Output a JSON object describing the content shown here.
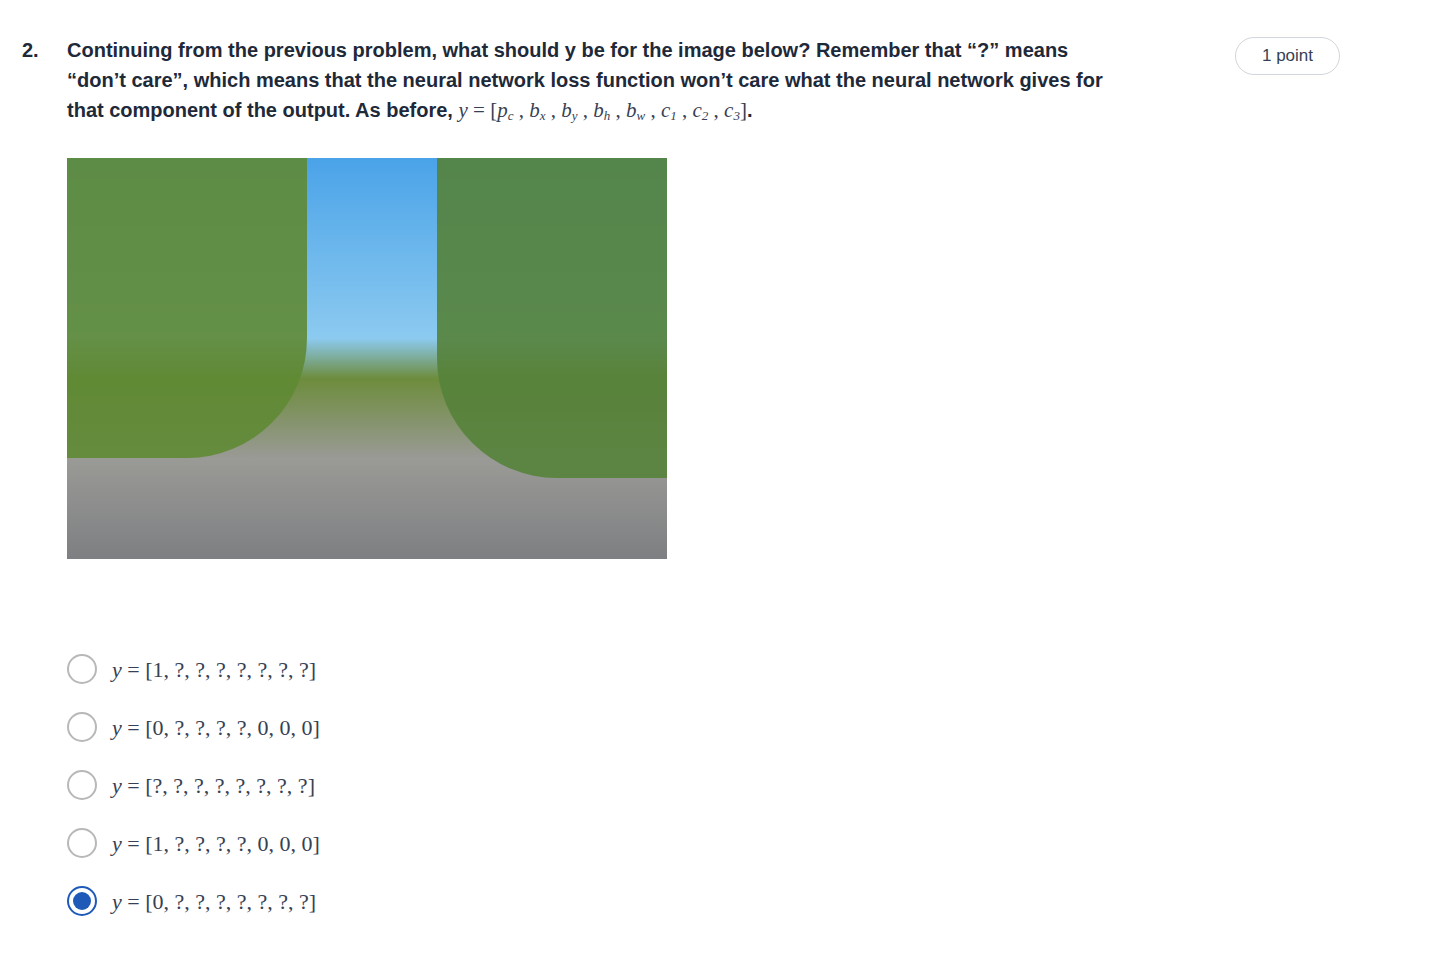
{
  "question": {
    "number": "2.",
    "text": "Continuing from the previous problem, what should y be for the image below? Remember that “?” means “don’t care”, which means that the neural network loss function won’t care what the neural network gives for that component of the output. As before,",
    "formula": {
      "var": "y",
      "eq": "=",
      "open": "[",
      "close": "]",
      "sep": ",",
      "end": ".",
      "parts": [
        {
          "base": "p",
          "sub": "c"
        },
        {
          "base": "b",
          "sub": "x"
        },
        {
          "base": "b",
          "sub": "y"
        },
        {
          "base": "b",
          "sub": "h"
        },
        {
          "base": "b",
          "sub": "w"
        },
        {
          "base": "c",
          "sub": "1"
        },
        {
          "base": "c",
          "sub": "2"
        },
        {
          "base": "c",
          "sub": "3"
        }
      ]
    }
  },
  "points": "1 point",
  "options": [
    {
      "var": "y",
      "eq": "=",
      "value": "[1, ?, ?, ?, ?, ?, ?, ?]",
      "selected": false
    },
    {
      "var": "y",
      "eq": "=",
      "value": "[0, ?, ?, ?, ?, 0, 0, 0]",
      "selected": false
    },
    {
      "var": "y",
      "eq": "=",
      "value": "[?, ?, ?, ?, ?, ?, ?, ?]",
      "selected": false
    },
    {
      "var": "y",
      "eq": "=",
      "value": "[1, ?, ?, ?, ?, 0, 0, 0]",
      "selected": false
    },
    {
      "var": "y",
      "eq": "=",
      "value": "[0, ?, ?, ?, ?, ?, ?, ?]",
      "selected": true
    }
  ]
}
